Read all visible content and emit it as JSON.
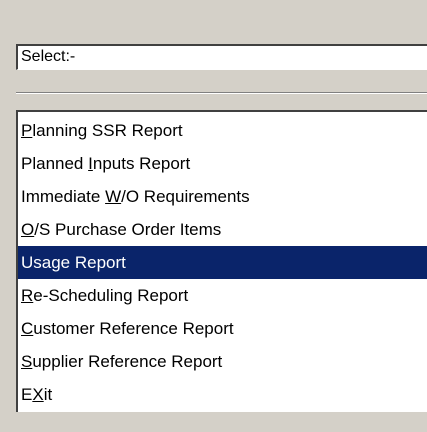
{
  "select_label": "Select:-",
  "menu": {
    "items": [
      {
        "mnemonic_pre": "",
        "mnemonic": "P",
        "mnemonic_post": "lanning SSR Report",
        "selected": false
      },
      {
        "mnemonic_pre": "Planned ",
        "mnemonic": "I",
        "mnemonic_post": "nputs Report",
        "selected": false
      },
      {
        "mnemonic_pre": "Immediate ",
        "mnemonic": "W",
        "mnemonic_post": "/O Requirements",
        "selected": false
      },
      {
        "mnemonic_pre": "",
        "mnemonic": "O",
        "mnemonic_post": "/S Purchase Order Items",
        "selected": false
      },
      {
        "mnemonic_pre": "Usage Report",
        "mnemonic": "",
        "mnemonic_post": "",
        "selected": true
      },
      {
        "mnemonic_pre": "",
        "mnemonic": "R",
        "mnemonic_post": "e-Scheduling Report",
        "selected": false
      },
      {
        "mnemonic_pre": "",
        "mnemonic": "C",
        "mnemonic_post": "ustomer Reference Report",
        "selected": false
      },
      {
        "mnemonic_pre": "",
        "mnemonic": "S",
        "mnemonic_post": "upplier Reference Report",
        "selected": false
      },
      {
        "mnemonic_pre": "E",
        "mnemonic": "X",
        "mnemonic_post": "it",
        "selected": false
      }
    ]
  },
  "colors": {
    "window_bg": "#d4d0c8",
    "selection_bg": "#0a246a",
    "selection_fg": "#ffffff"
  }
}
